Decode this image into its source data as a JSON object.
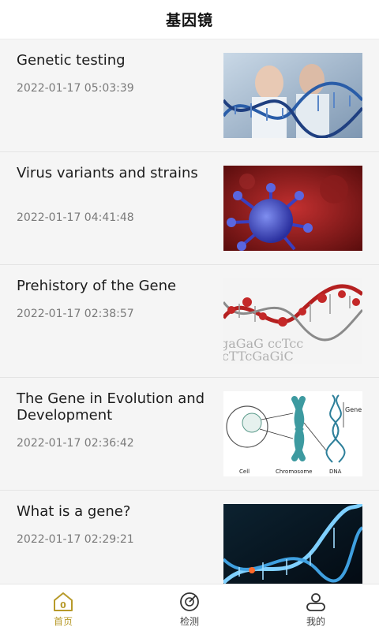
{
  "header": {
    "title": "基因镜"
  },
  "articles": [
    {
      "title": "Genetic testing",
      "date": "2022-01-17 05:03:39",
      "image": "scientists-dna-image"
    },
    {
      "title": "Virus variants and strains",
      "date": "2022-01-17 04:41:48",
      "image": "virus-image"
    },
    {
      "title": "Prehistory of the Gene",
      "date": "2022-01-17 02:38:57",
      "image": "dna-sequence-image"
    },
    {
      "title": "The Gene in Evolution and Development",
      "date": "2022-01-17 02:36:42",
      "image": "cell-chromosome-diagram",
      "diagram_labels": {
        "cell": "Cell",
        "chromosome": "Chromosome",
        "dna": "DNA",
        "gene": "Gene"
      }
    },
    {
      "title": "What is a gene?",
      "date": "2022-01-17 02:29:21",
      "image": "dna-helix-blue-image"
    }
  ],
  "tabbar": {
    "items": [
      {
        "label": "首页",
        "icon": "home-icon",
        "badge": "0",
        "active": true
      },
      {
        "label": "检测",
        "icon": "scan-icon",
        "active": false
      },
      {
        "label": "我的",
        "icon": "profile-icon",
        "active": false
      }
    ]
  },
  "colors": {
    "active_tab": "#b79a2a",
    "background": "#f5f5f5"
  }
}
